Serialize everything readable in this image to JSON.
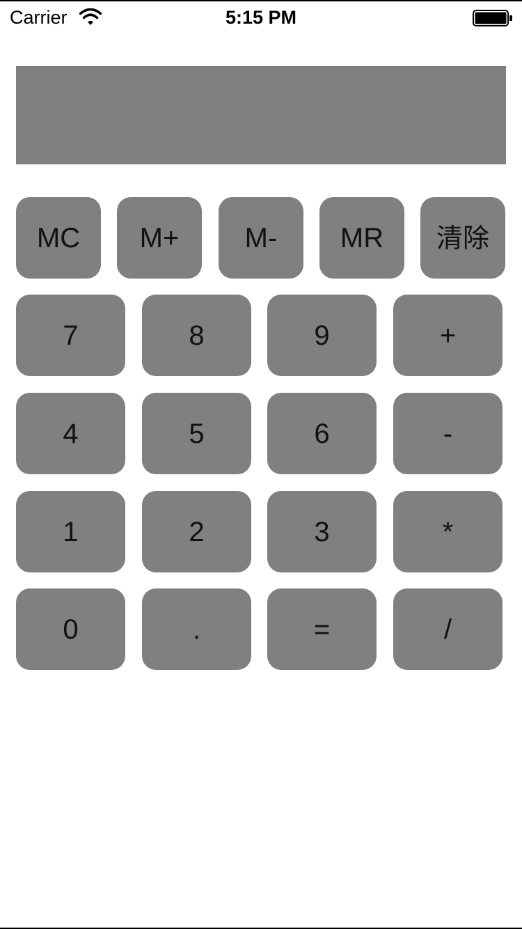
{
  "status_bar": {
    "carrier": "Carrier",
    "time": "5:15 PM",
    "wifi_icon": "wifi-icon",
    "battery_icon": "battery-full-icon"
  },
  "display": {
    "value": ""
  },
  "colors": {
    "key_background": "#808080",
    "display_background": "#808080",
    "page_background": "#ffffff"
  },
  "memory_row": [
    "MC",
    "M+",
    "M-",
    "MR",
    "清除"
  ],
  "keypad": [
    [
      "7",
      "8",
      "9",
      "+"
    ],
    [
      "4",
      "5",
      "6",
      "-"
    ],
    [
      "1",
      "2",
      "3",
      "*"
    ],
    [
      "0",
      ".",
      "=",
      "/"
    ]
  ]
}
